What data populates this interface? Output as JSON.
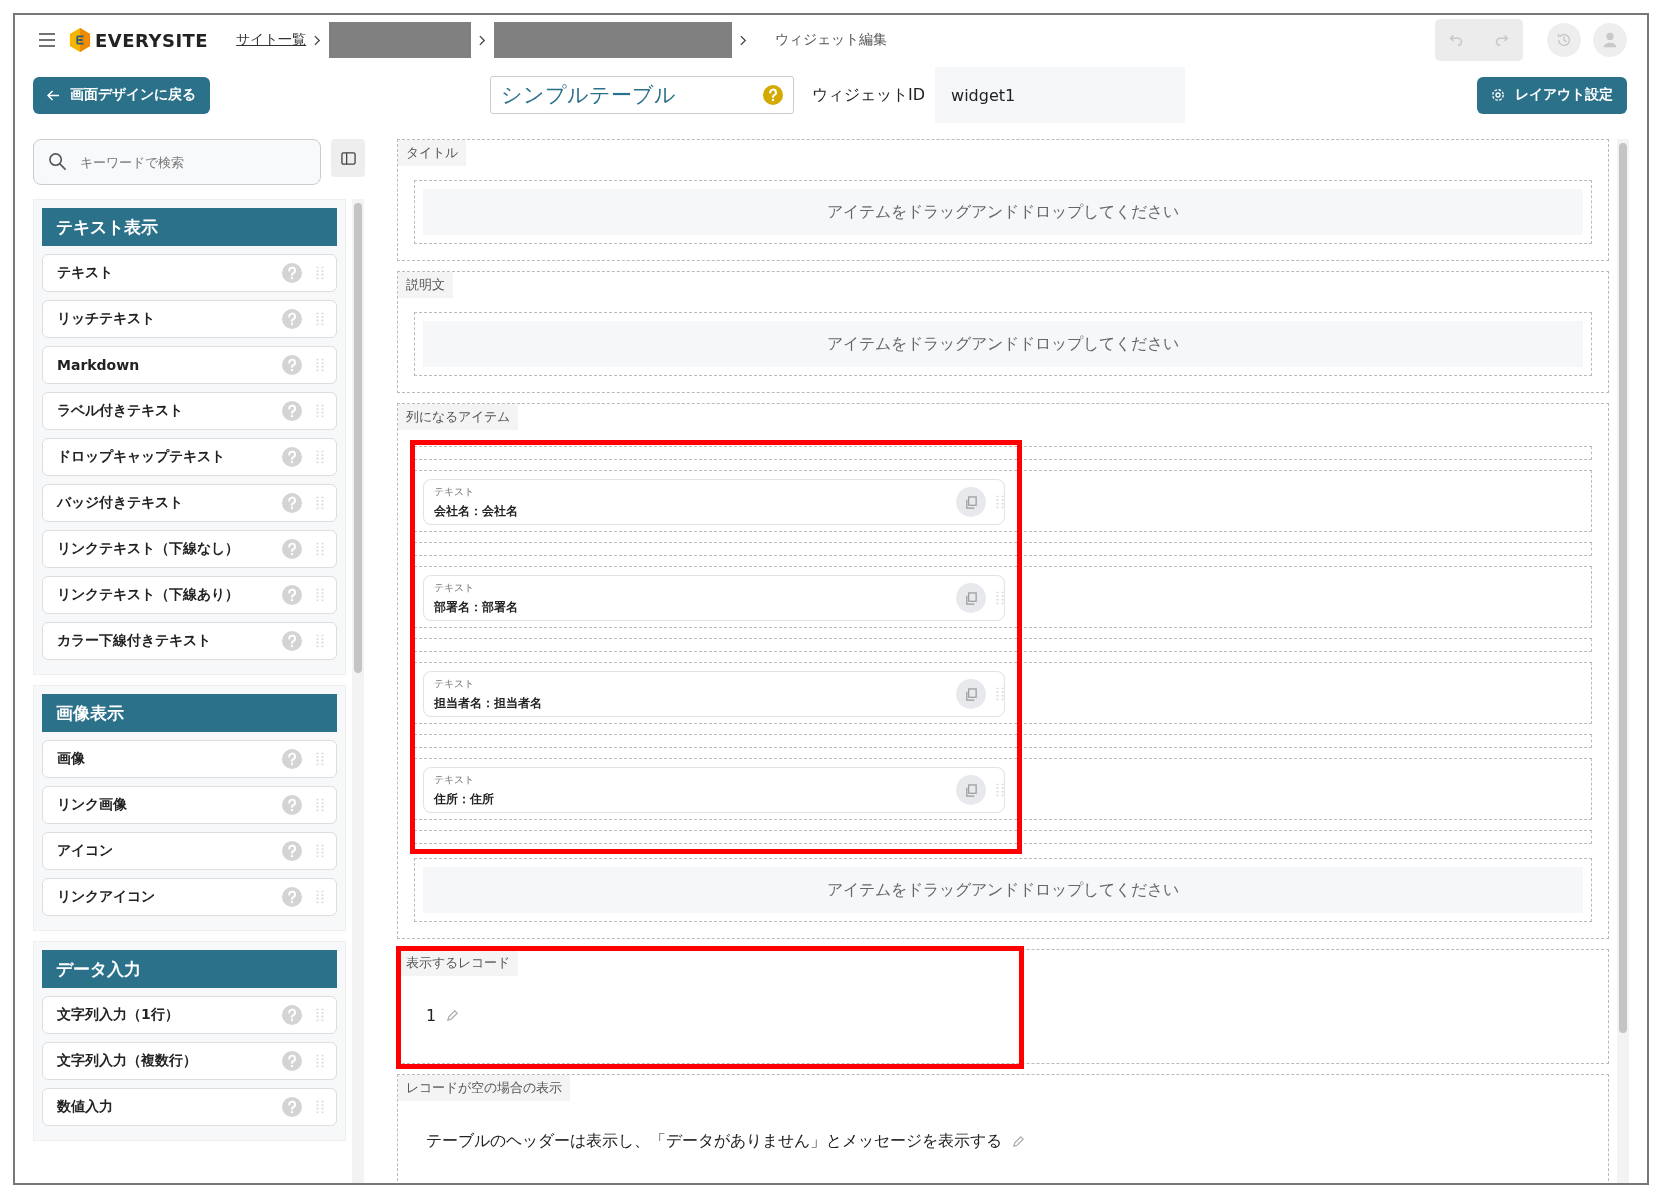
{
  "header": {
    "logo": "EVERYSITE",
    "breadcrumbs": [
      {
        "kind": "link",
        "label": "サイト一覧"
      },
      {
        "kind": "redacted"
      },
      {
        "kind": "redacted"
      },
      {
        "kind": "current",
        "label": "ウィジェット編集"
      }
    ],
    "toolbar": [
      {
        "kind": "undo",
        "disabled": true
      },
      {
        "kind": "redo",
        "disabled": true
      }
    ]
  },
  "back_button": "画面デザインに戻る",
  "widget_name": "シンプルテーブル",
  "widget_id": {
    "label": "ウィジェットID",
    "value": "widget1"
  },
  "layout_button": "レイアウト設定",
  "search": {
    "placeholder": "キーワードで検索"
  },
  "palette": [
    {
      "title": "テキスト表示",
      "items": [
        "テキスト",
        "リッチテキスト",
        "Markdown",
        "ラベル付きテキスト",
        "ドロップキャップテキスト",
        "バッジ付きテキスト",
        "リンクテキスト（下線なし）",
        "リンクテキスト（下線あり）",
        "カラー下線付きテキスト"
      ]
    },
    {
      "title": "画像表示",
      "items": [
        "画像",
        "リンク画像",
        "アイコン",
        "リンクアイコン"
      ]
    },
    {
      "title": "データ入力",
      "items": [
        "文字列入力（1行）",
        "文字列入力（複数行）",
        "数値入力"
      ]
    }
  ],
  "canvas": {
    "sections": [
      {
        "kind": "dropzone",
        "label": "タイトル",
        "hint": "アイテムをドラッグアンドドロップしてください"
      },
      {
        "kind": "dropzone",
        "label": "説明文",
        "hint": "アイテムをドラッグアンドドロップしてください"
      },
      {
        "kind": "items",
        "label": "列になるアイテム",
        "items_highlighted": true,
        "items": [
          {
            "type_label": "テキスト",
            "text": "会社名：会社名"
          },
          {
            "type_label": "テキスト",
            "text": "部署名：部署名"
          },
          {
            "type_label": "テキスト",
            "text": "担当者名：担当者名"
          },
          {
            "type_label": "テキスト",
            "text": "住所：住所"
          }
        ],
        "hint": "アイテムをドラッグアンドドロップしてください"
      },
      {
        "kind": "value",
        "label": "表示するレコード",
        "value": "1",
        "highlighted": true
      },
      {
        "kind": "value",
        "label": "レコードが空の場合の表示",
        "value": "テーブルのヘッダーは表示し、「データがありません」とメッセージを表示する",
        "highlighted": false
      }
    ]
  }
}
